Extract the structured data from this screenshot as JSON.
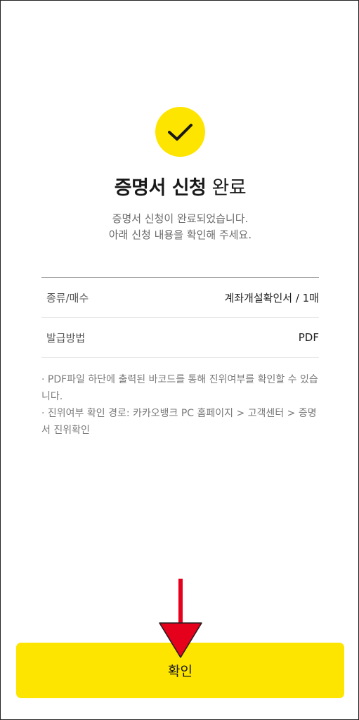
{
  "header": {
    "title_bold": "증명서 신청",
    "title_light": "완료",
    "subtitle_line1": "증명서 신청이 완료되었습니다.",
    "subtitle_line2": "아래 신청 내용을 확인해 주세요."
  },
  "details": [
    {
      "label": "종류/매수",
      "value": "계좌개설확인서 / 1매"
    },
    {
      "label": "발급방법",
      "value": "PDF"
    }
  ],
  "notes": [
    "· PDF파일 하단에 출력된 바코드를 통해 진위여부를 확인할 수 있습니다.",
    "· 진위여부 확인 경로: 카카오뱅크 PC 홈페이지 > 고객센터 > 증명서 진위확인"
  ],
  "confirm_button": {
    "label": "확인"
  },
  "icons": {
    "status": "check-icon",
    "annotation": "red-arrow-down-icon"
  },
  "colors": {
    "accent": "#fee500",
    "arrow": "#e5001b"
  }
}
